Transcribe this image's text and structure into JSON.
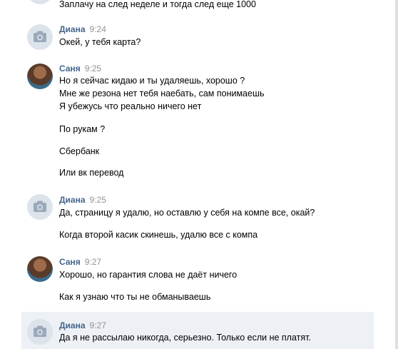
{
  "colors": {
    "author": "#42648b",
    "time": "#939393",
    "highlight": "#edf0f5",
    "avatar_placeholder": "#dce3eb"
  },
  "top_partial": {
    "text": "Заплачу на след неделе и тогда след еще 1000"
  },
  "messages": [
    {
      "author": "Диана",
      "time": "9:24",
      "avatar": "camera-icon",
      "lines": [
        "Окей, у тебя карта?"
      ]
    },
    {
      "author": "Саня",
      "time": "9:25",
      "avatar": "photo",
      "lines": [
        "Но я сейчас кидаю и ты удаляешь, хорошо ?",
        "Мне же резона нет тебя наебать, сам понимаешь",
        "Я убежусь что реально ничего нет",
        "По рукам ?",
        "Сбербанк",
        "Или вк перевод"
      ]
    },
    {
      "author": "Диана",
      "time": "9:25",
      "avatar": "camera-icon",
      "lines": [
        "Да, страницу я удалю, но оставлю у себя на компе все, окай?",
        "Когда второй касик скинешь, удалю все с компа"
      ]
    },
    {
      "author": "Саня",
      "time": "9:27",
      "avatar": "photo",
      "lines": [
        "Хорошо, но гарантия слова не даёт ничего",
        "Как я узнаю что ты не обманываешь"
      ]
    },
    {
      "author": "Диана",
      "time": "9:27",
      "avatar": "camera-icon",
      "lines": [
        "Да я не рассылаю никогда, серьезно. Только если не платят."
      ]
    }
  ]
}
